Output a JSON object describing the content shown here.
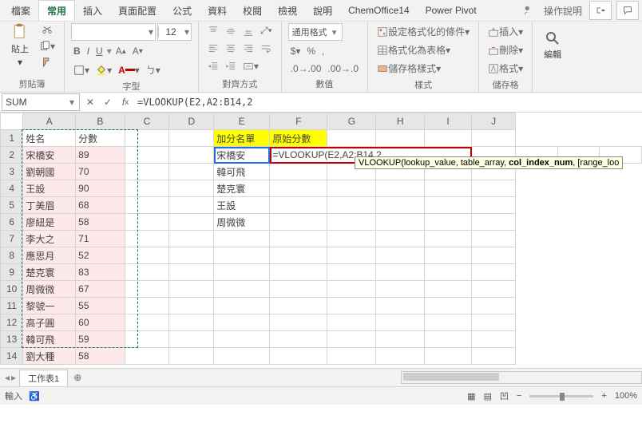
{
  "tabs": {
    "file": "檔案",
    "home": "常用",
    "insert": "插入",
    "layout": "頁面配置",
    "formulas": "公式",
    "data": "資料",
    "review": "校閱",
    "view": "檢視",
    "help": "說明",
    "chem": "ChemOffice14",
    "pivot": "Power Pivot",
    "tell": "操作說明"
  },
  "groups": {
    "clipboard": "剪貼簿",
    "font": "字型",
    "align": "對齊方式",
    "number": "數值",
    "styles": "樣式",
    "cells": "儲存格",
    "editing": "編輯"
  },
  "clipboard": {
    "paste": "貼上"
  },
  "font": {
    "name": "",
    "size": "12",
    "bold": "B",
    "italic": "I",
    "underline": "U"
  },
  "number": {
    "format": "通用格式"
  },
  "styles": {
    "cond": "設定格式化的條件",
    "table": "格式化為表格",
    "cell": "儲存格樣式"
  },
  "cells": {
    "insert": "插入",
    "delete": "刪除",
    "format": "格式"
  },
  "editing": {
    "label": "編輯"
  },
  "name_box": "SUM",
  "fx": "=VLOOKUP(E2,A2:B14,2",
  "headers": {
    "A": "姓名",
    "B": "分數",
    "E": "加分名單",
    "F": "原始分數"
  },
  "col": [
    "A",
    "B",
    "C",
    "D",
    "E",
    "F",
    "G",
    "H",
    "I",
    "J"
  ],
  "rows": [
    {
      "A": "宋橋安",
      "B": "89",
      "E": "宋橋安",
      "F": "=VLOOKUP(E2,A2:B14,2"
    },
    {
      "A": "劉朝國",
      "B": "70",
      "E": "韓可飛",
      "F": ""
    },
    {
      "A": "王設",
      "B": "90",
      "E": "楚克寰",
      "F": ""
    },
    {
      "A": "丁美眉",
      "B": "68",
      "E": "王設",
      "F": ""
    },
    {
      "A": "廖紐是",
      "B": "58",
      "E": "周微微",
      "F": ""
    },
    {
      "A": "李大之",
      "B": "71",
      "E": "",
      "F": ""
    },
    {
      "A": "應思月",
      "B": "52",
      "E": "",
      "F": ""
    },
    {
      "A": "楚克寰",
      "B": "83",
      "E": "",
      "F": ""
    },
    {
      "A": "周微微",
      "B": "67",
      "E": "",
      "F": ""
    },
    {
      "A": "黎號一",
      "B": "55",
      "E": "",
      "F": ""
    },
    {
      "A": "高子圓",
      "B": "60",
      "E": "",
      "F": ""
    },
    {
      "A": "韓可飛",
      "B": "59",
      "E": "",
      "F": ""
    },
    {
      "A": "劉大種",
      "B": "58",
      "E": "",
      "F": ""
    }
  ],
  "tooltip": {
    "fn": "VLOOKUP(",
    "a1": "lookup_value",
    "a2": "table_array",
    "a3": "col_index_num",
    "a4": "[range_loo"
  },
  "sheet_tab": "工作表1",
  "status": "輸入",
  "zoom": "100%"
}
